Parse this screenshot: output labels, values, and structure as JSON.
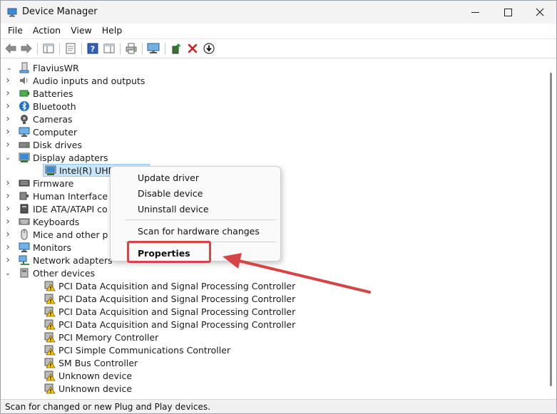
{
  "window": {
    "title": "Device Manager"
  },
  "menubar": [
    "File",
    "Action",
    "View",
    "Help"
  ],
  "tree": {
    "root": "FlaviusWR",
    "items": [
      {
        "label": "Audio inputs and outputs",
        "icon": "speaker-icon",
        "level": 1,
        "expanded": false
      },
      {
        "label": "Batteries",
        "icon": "battery-icon",
        "level": 1,
        "expanded": false
      },
      {
        "label": "Bluetooth",
        "icon": "bluetooth-icon",
        "level": 1,
        "expanded": false
      },
      {
        "label": "Cameras",
        "icon": "camera-icon",
        "level": 1,
        "expanded": false
      },
      {
        "label": "Computer",
        "icon": "computer-icon",
        "level": 1,
        "expanded": false
      },
      {
        "label": "Disk drives",
        "icon": "disk-icon",
        "level": 1,
        "expanded": false
      },
      {
        "label": "Display adapters",
        "icon": "display-adapter-icon",
        "level": 1,
        "expanded": true
      },
      {
        "label": "Intel(R) UHD",
        "icon": "display-adapter-icon",
        "level": 2,
        "selected": true
      },
      {
        "label": "Firmware",
        "icon": "firmware-icon",
        "level": 1,
        "expanded": false
      },
      {
        "label": "Human Interface",
        "icon": "hid-icon",
        "level": 1,
        "expanded": false
      },
      {
        "label": "IDE ATA/ATAPI co",
        "icon": "ide-icon",
        "level": 1,
        "expanded": false
      },
      {
        "label": "Keyboards",
        "icon": "keyboard-icon",
        "level": 1,
        "expanded": false
      },
      {
        "label": "Mice and other p",
        "icon": "mouse-icon",
        "level": 1,
        "expanded": false
      },
      {
        "label": "Monitors",
        "icon": "monitor-icon",
        "level": 1,
        "expanded": false
      },
      {
        "label": "Network adapters",
        "icon": "network-icon",
        "level": 1,
        "expanded": false
      },
      {
        "label": "Other devices",
        "icon": "other-devices-icon",
        "level": 1,
        "expanded": true
      },
      {
        "label": "PCI Data Acquisition and Signal Processing Controller",
        "icon": "warning-device-icon",
        "level": 2
      },
      {
        "label": "PCI Data Acquisition and Signal Processing Controller",
        "icon": "warning-device-icon",
        "level": 2
      },
      {
        "label": "PCI Data Acquisition and Signal Processing Controller",
        "icon": "warning-device-icon",
        "level": 2
      },
      {
        "label": "PCI Data Acquisition and Signal Processing Controller",
        "icon": "warning-device-icon",
        "level": 2
      },
      {
        "label": "PCI Memory Controller",
        "icon": "warning-device-icon",
        "level": 2
      },
      {
        "label": "PCI Simple Communications Controller",
        "icon": "warning-device-icon",
        "level": 2
      },
      {
        "label": "SM Bus Controller",
        "icon": "warning-device-icon",
        "level": 2
      },
      {
        "label": "Unknown device",
        "icon": "warning-device-icon",
        "level": 2
      },
      {
        "label": "Unknown device",
        "icon": "warning-device-icon",
        "level": 2
      }
    ]
  },
  "context_menu": {
    "update": "Update driver",
    "disable": "Disable device",
    "uninstall": "Uninstall device",
    "scan": "Scan for hardware changes",
    "properties": "Properties"
  },
  "statusbar": {
    "text": "Scan for changed or new Plug and Play devices."
  },
  "colors": {
    "selection": "#cce4f7",
    "annotation": "#d64545"
  }
}
